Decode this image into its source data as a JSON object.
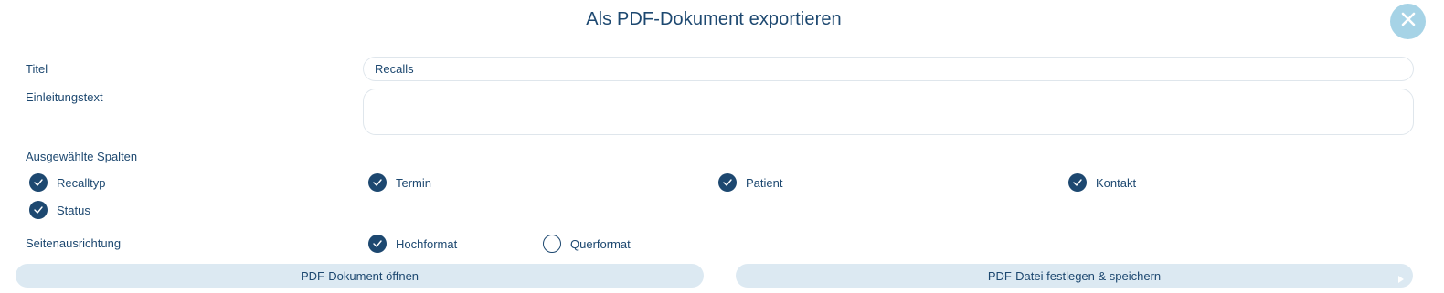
{
  "dialog": {
    "title": "Als PDF-Dokument exportieren",
    "close_icon": "close-icon",
    "close_color": "#a6d3e6"
  },
  "form": {
    "title_label": "Titel",
    "title_value": "Recalls",
    "intro_label": "Einleitungstext",
    "intro_value": "",
    "columns_label": "Ausgewählte Spalten",
    "columns": [
      {
        "label": "Recalltyp",
        "checked": true
      },
      {
        "label": "Termin",
        "checked": true
      },
      {
        "label": "Patient",
        "checked": true
      },
      {
        "label": "Kontakt",
        "checked": true
      },
      {
        "label": "Status",
        "checked": true
      }
    ],
    "orientation_label": "Seitenausrichtung",
    "orientation_options": [
      {
        "label": "Hochformat",
        "checked": true
      },
      {
        "label": "Querformat",
        "checked": false
      }
    ]
  },
  "actions": {
    "open_label": "PDF-Dokument öffnen",
    "save_label": "PDF-Datei festlegen & speichern"
  },
  "colors": {
    "primary": "#1d4870",
    "button_bg": "#dce9f2",
    "input_border": "#dfe6ec"
  }
}
